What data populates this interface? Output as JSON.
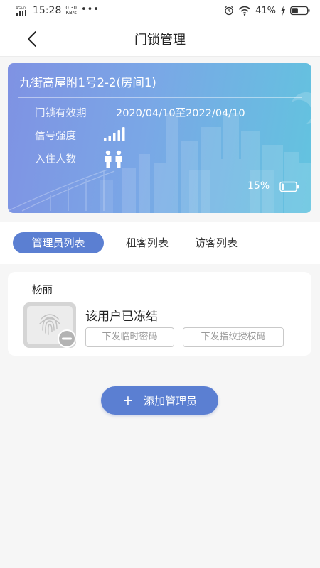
{
  "status_bar": {
    "network": "4G HD",
    "time": "15:28",
    "speed_value": "0.30",
    "speed_unit": "KB/s",
    "more": "•••",
    "battery_percent": "41%",
    "battery_level": 0.41
  },
  "header": {
    "title": "门锁管理"
  },
  "lock_card": {
    "room": "九街高屋附1号2-2(房间1)",
    "validity_label": "门锁有效期",
    "validity_value": "2020/04/10至2022/04/10",
    "signal_label": "信号强度",
    "signal_bars": 4,
    "occupants_label": "入住人数",
    "occupants_count": 2,
    "battery_text": "15%",
    "battery_level": 0.15
  },
  "tabs": [
    {
      "label": "管理员列表",
      "active": true
    },
    {
      "label": "租客列表",
      "active": false
    },
    {
      "label": "访客列表",
      "active": false
    }
  ],
  "admin": {
    "name": "杨丽",
    "status": "该用户已冻结",
    "temp_password_btn": "下发临时密码",
    "fingerprint_btn": "下发指纹授权码"
  },
  "add_admin": {
    "icon": "+",
    "label": "添加管理员"
  },
  "colors": {
    "accent": "#5b7fd2",
    "card_gradient_start": "#7f92e3",
    "card_gradient_end": "#62c4df"
  }
}
